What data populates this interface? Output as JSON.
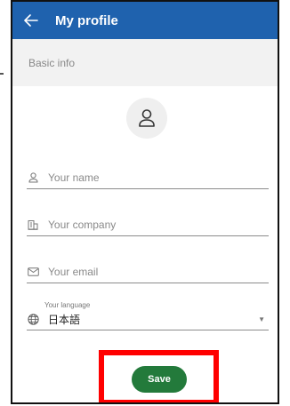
{
  "appbar": {
    "title": "My profile"
  },
  "section": {
    "title": "Basic info"
  },
  "form": {
    "name_placeholder": "Your name",
    "company_placeholder": "Your company",
    "email_placeholder": "Your email",
    "language_label": "Your language",
    "language_value": "日本語",
    "save_label": "Save"
  },
  "colors": {
    "appbar": "#1f62ae",
    "save_button": "#237a3b",
    "highlight": "#ff0000"
  }
}
